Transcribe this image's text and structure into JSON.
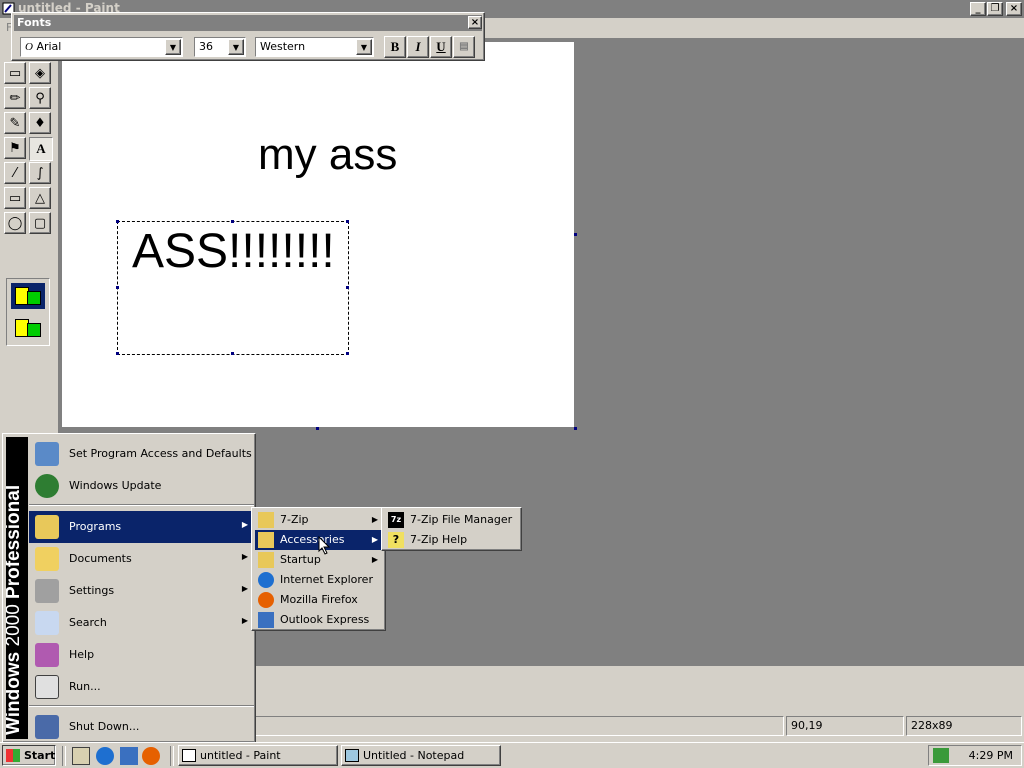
{
  "window": {
    "title": "untitled - Paint"
  },
  "menubar": {
    "first_menu": "File"
  },
  "canvas": {
    "text1": "my ass",
    "text2": "ASS!!!!!!!!"
  },
  "fonts_toolbar": {
    "title": "Fonts",
    "font_name": "Arial",
    "font_size": "36",
    "script": "Western",
    "bold_label": "B",
    "italic_label": "I",
    "underline_label": "U"
  },
  "status": {
    "coords": "90,19",
    "size": "228x89"
  },
  "start_menu": {
    "brand": "Windows 2000 Professional",
    "brand_main": "Windows",
    "brand_version": "2000",
    "brand_edition": "Professional",
    "items": [
      {
        "label": "Set Program Access and Defaults",
        "icon": "program-defaults-icon"
      },
      {
        "label": "Windows Update",
        "icon": "windows-update-icon"
      },
      {
        "label": "Programs",
        "icon": "programs-folder-icon"
      },
      {
        "label": "Documents",
        "icon": "documents-folder-icon"
      },
      {
        "label": "Settings",
        "icon": "settings-icon"
      },
      {
        "label": "Search",
        "icon": "search-icon"
      },
      {
        "label": "Help",
        "icon": "help-icon"
      },
      {
        "label": "Run...",
        "icon": "run-icon"
      },
      {
        "label": "Shut Down...",
        "icon": "shutdown-icon"
      }
    ]
  },
  "programs_menu": {
    "items": [
      {
        "label": "7-Zip",
        "icon": "folder-icon"
      },
      {
        "label": "Accessories",
        "icon": "folder-icon"
      },
      {
        "label": "Startup",
        "icon": "folder-icon"
      },
      {
        "label": "Internet Explorer",
        "icon": "ie-icon"
      },
      {
        "label": "Mozilla Firefox",
        "icon": "firefox-icon"
      },
      {
        "label": "Outlook Express",
        "icon": "outlook-icon"
      }
    ]
  },
  "sevenzip_menu": {
    "items": [
      {
        "label": "7-Zip File Manager",
        "icon": "7zip-icon"
      },
      {
        "label": "7-Zip Help",
        "icon": "help-file-icon"
      }
    ]
  },
  "taskbar": {
    "start_label": "Start",
    "tasks": [
      {
        "label": "untitled - Paint",
        "icon": "paint-icon"
      },
      {
        "label": "Untitled - Notepad",
        "icon": "notepad-icon"
      }
    ],
    "clock": "4:29 PM"
  },
  "colors": {
    "selection": "#0a246a",
    "face": "#d4d0c8",
    "workspace": "#808080"
  }
}
